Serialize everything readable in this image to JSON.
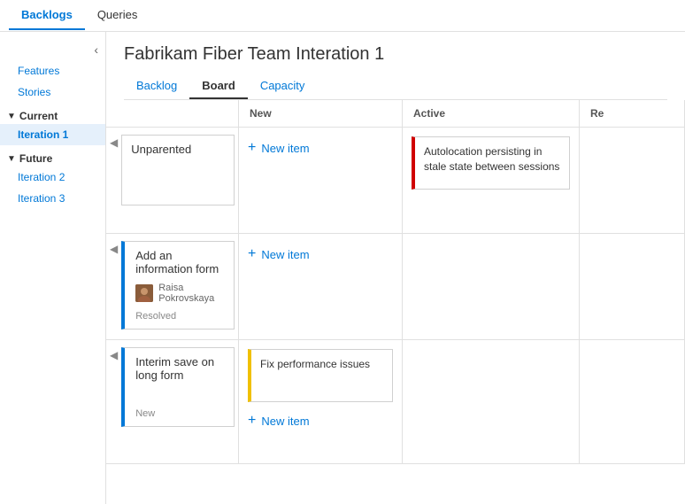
{
  "topTabs": [
    {
      "label": "Backlogs",
      "active": true
    },
    {
      "label": "Queries",
      "active": false
    }
  ],
  "sidebar": {
    "collapseBtn": "‹",
    "quickLinks": [
      {
        "label": "Features",
        "active": false
      },
      {
        "label": "Stories",
        "active": false
      }
    ],
    "groups": [
      {
        "label": "Current",
        "items": [
          {
            "label": "Iteration 1",
            "active": true
          }
        ]
      },
      {
        "label": "Future",
        "items": [
          {
            "label": "Iteration 2",
            "active": false
          },
          {
            "label": "Iteration 3",
            "active": false
          }
        ]
      }
    ]
  },
  "content": {
    "title": "Fabrikam Fiber Team Interation 1",
    "tabs": [
      {
        "label": "Backlog",
        "active": false
      },
      {
        "label": "Board",
        "active": true
      },
      {
        "label": "Capacity",
        "active": false
      }
    ]
  },
  "board": {
    "columns": [
      {
        "label": "",
        "key": "swimlane"
      },
      {
        "label": "New",
        "key": "new"
      },
      {
        "label": "Active",
        "key": "active"
      },
      {
        "label": "Re",
        "key": "resolved"
      }
    ],
    "rows": [
      {
        "swimlane": {
          "title": "Unparented"
        },
        "newItems": [],
        "activeItems": [
          {
            "title": "Autolocation persisting in stale state between sessions",
            "barColor": "red"
          }
        ],
        "resolvedItems": []
      },
      {
        "swimlane": {
          "title": "Add an information form",
          "userName": "Raisa Pokrovskaya",
          "status": "Resolved"
        },
        "newItems": [],
        "activeItems": [],
        "resolvedItems": []
      },
      {
        "swimlane": {
          "title": "Interim save on long form",
          "status": "New"
        },
        "newItems": [
          {
            "title": "Fix performance issues",
            "barColor": "yellow"
          }
        ],
        "activeItems": [],
        "resolvedItems": []
      }
    ],
    "newItemLabel": "New item"
  }
}
